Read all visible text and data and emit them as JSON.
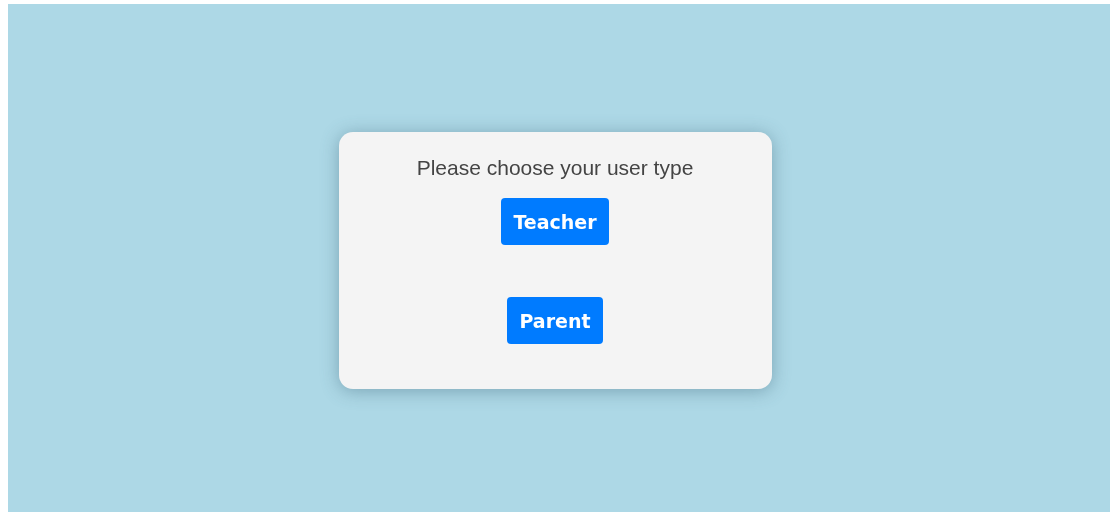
{
  "dialog": {
    "title": "Please choose your user type"
  },
  "buttons": [
    {
      "label": "Teacher"
    },
    {
      "label": "Parent"
    }
  ]
}
